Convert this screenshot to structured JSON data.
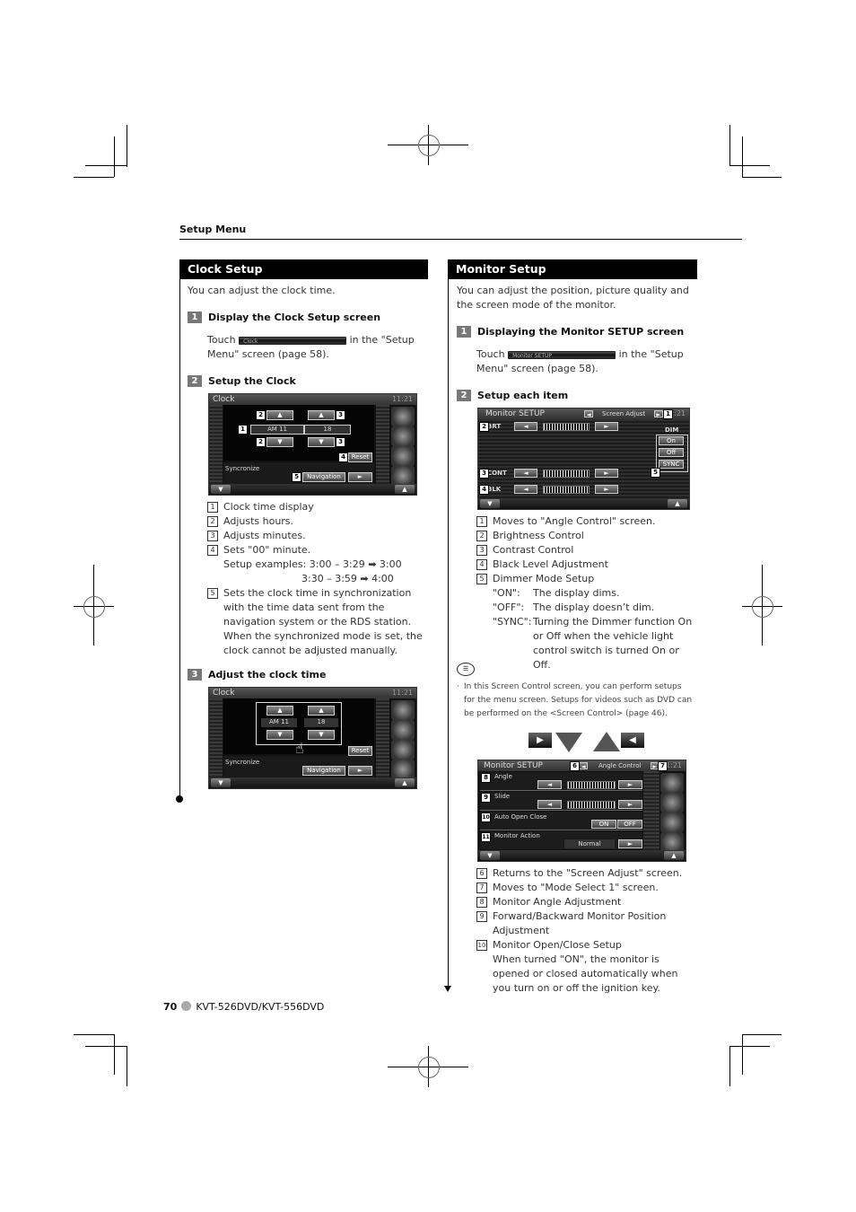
{
  "header": {
    "section_label": "Setup Menu"
  },
  "clock_setup": {
    "title": "Clock Setup",
    "intro": "You can adjust the clock time.",
    "step1": {
      "num": "1",
      "title": "Display the Clock Setup screen",
      "text_before": "Touch",
      "button_label": "Clock",
      "text_after": "in the \"Setup",
      "text_line2": "Menu\" screen (page 58)."
    },
    "step2": {
      "num": "2",
      "title": "Setup the Clock"
    },
    "screen": {
      "title": "Clock",
      "time": "11:21",
      "hour_value": "AM 11",
      "minute_value": "18",
      "reset_label": "Reset",
      "sync_label": "Syncronize",
      "nav_label": "Navigation",
      "up_arrow": "▲",
      "down_arrow": "▼",
      "right_arrow": "►"
    },
    "legend": [
      {
        "n": "1",
        "text": "Clock time display"
      },
      {
        "n": "2",
        "text": "Adjusts hours."
      },
      {
        "n": "3",
        "text": "Adjusts minutes."
      },
      {
        "n": "4",
        "text": "Sets \"00\" minute."
      },
      {
        "n": "5",
        "text": "Sets the clock time in synchronization with the time data sent from the navigation system or the RDS station."
      }
    ],
    "examples_label": "Setup examples:",
    "example1": "3:00 – 3:29 ➡ 3:00",
    "example2": "3:30 – 3:59 ➡ 4:00",
    "sync_note": "When the synchronized mode is set, the clock cannot be adjusted manually.",
    "step3": {
      "num": "3",
      "title": "Adjust the clock time"
    }
  },
  "monitor_setup": {
    "title": "Monitor Setup",
    "intro": "You can adjust the position, picture quality and the screen mode of the monitor.",
    "step1": {
      "num": "1",
      "title": "Displaying the Monitor SETUP screen",
      "text_before": "Touch",
      "button_label": "Monitor SETUP",
      "text_after": "in the \"Setup",
      "text_line2": "Menu\" screen (page 58)."
    },
    "step2": {
      "num": "2",
      "title": "Setup each item"
    },
    "screen1": {
      "title": "Monitor SETUP",
      "subtitle": "Screen Adjust",
      "time": "11:21",
      "brt": "BRT",
      "cont": "CONT",
      "blk": "BLK",
      "dim": "DIM",
      "dim_on": "On",
      "dim_off": "Off",
      "dim_sync": "SYNC"
    },
    "legend1": [
      {
        "n": "1",
        "text": "Moves to \"Angle Control\" screen."
      },
      {
        "n": "2",
        "text": "Brightness Control"
      },
      {
        "n": "3",
        "text": "Contrast Control"
      },
      {
        "n": "4",
        "text": "Black Level Adjustment"
      },
      {
        "n": "5",
        "text": "Dimmer Mode Setup"
      }
    ],
    "dim_modes": [
      {
        "k": "\"ON\":",
        "v": "The display dims."
      },
      {
        "k": "\"OFF\":",
        "v": "The display doesn’t dim."
      },
      {
        "k": "\"SYNC\":",
        "v": "Turning the Dimmer function On or Off when the vehicle light control switch is turned On or Off."
      }
    ],
    "note": "In this Screen Control screen, you can perform setups for the menu screen. Setups for videos such as DVD can be performed on the <Screen Control> (page 46).",
    "screen2": {
      "title": "Monitor SETUP",
      "subtitle": "Angle Control",
      "time": "11:21",
      "angle": "Angle",
      "slide": "Slide",
      "auto": "Auto Open Close",
      "on": "ON",
      "off": "OFF",
      "action": "Monitor Action",
      "normal": "Normal"
    },
    "legend2": [
      {
        "n": "6",
        "text": "Returns to the \"Screen Adjust\" screen."
      },
      {
        "n": "7",
        "text": "Moves to \"Mode Select 1\" screen."
      },
      {
        "n": "8",
        "text": "Monitor Angle Adjustment"
      },
      {
        "n": "9",
        "text": "Forward/Backward Monitor Position Adjustment"
      },
      {
        "n": "10",
        "text": "Monitor Open/Close Setup"
      }
    ],
    "open_close_note": "When turned \"ON\", the monitor is opened or closed automatically when you turn on or off the ignition key."
  },
  "footer": {
    "page": "70",
    "model": "KVT-526DVD/KVT-556DVD"
  }
}
